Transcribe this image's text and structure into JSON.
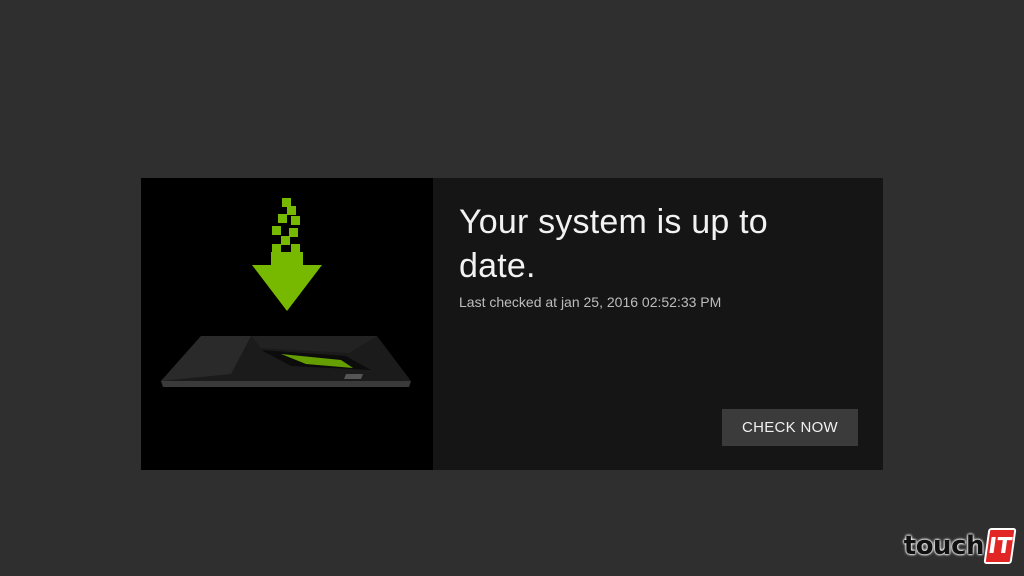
{
  "dialog": {
    "title": "Your system is up to date.",
    "last_checked": "Last checked at jan 25, 2016 02:52:33 PM",
    "check_button_label": "CHECK NOW"
  },
  "hero": {
    "icon": "download-arrow-icon",
    "device": "console-device-illustration",
    "accent_color": "#76b900"
  },
  "watermark": {
    "text": "touch",
    "badge": "IT"
  }
}
